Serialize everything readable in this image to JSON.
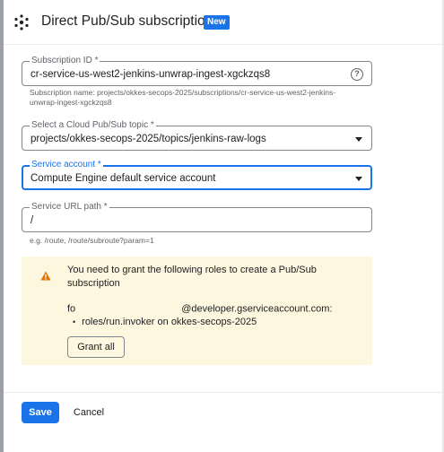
{
  "header": {
    "title": "Direct Pub/Sub subscription",
    "badge": "New",
    "logo_icon": "pubsub-logo-icon"
  },
  "subscription_id": {
    "label": "Subscription ID *",
    "value": "cr-service-us-west2-jenkins-unwrap-ingest-xgckzqs8",
    "help_icon": "help-icon",
    "hint": "Subscription name: projects/okkes-secops-2025/subscriptions/cr-service-us-west2-jenkins-unwrap-ingest-xgckzqs8"
  },
  "topic": {
    "label": "Select a Cloud Pub/Sub topic *",
    "value": "projects/okkes-secops-2025/topics/jenkins-raw-logs"
  },
  "service_account": {
    "label": "Service account *",
    "value": "Compute Engine default service account"
  },
  "service_url": {
    "label": "Service URL path *",
    "value": "/",
    "hint": "e.g. /route, /route/subroute?param=1"
  },
  "warning": {
    "icon": "warning-icon",
    "message": "You need to grant the following roles to create a Pub/Sub subscription",
    "email_prefix": "fo",
    "email_suffix": "@developer.gserviceaccount.com:",
    "role": "roles/run.invoker on okkes-secops-2025",
    "grant_label": "Grant all"
  },
  "footer": {
    "save_label": "Save",
    "cancel_label": "Cancel"
  },
  "colors": {
    "primary": "#1a73e8",
    "warning_bg": "#fef7e0",
    "warning_icon": "#e37400"
  }
}
